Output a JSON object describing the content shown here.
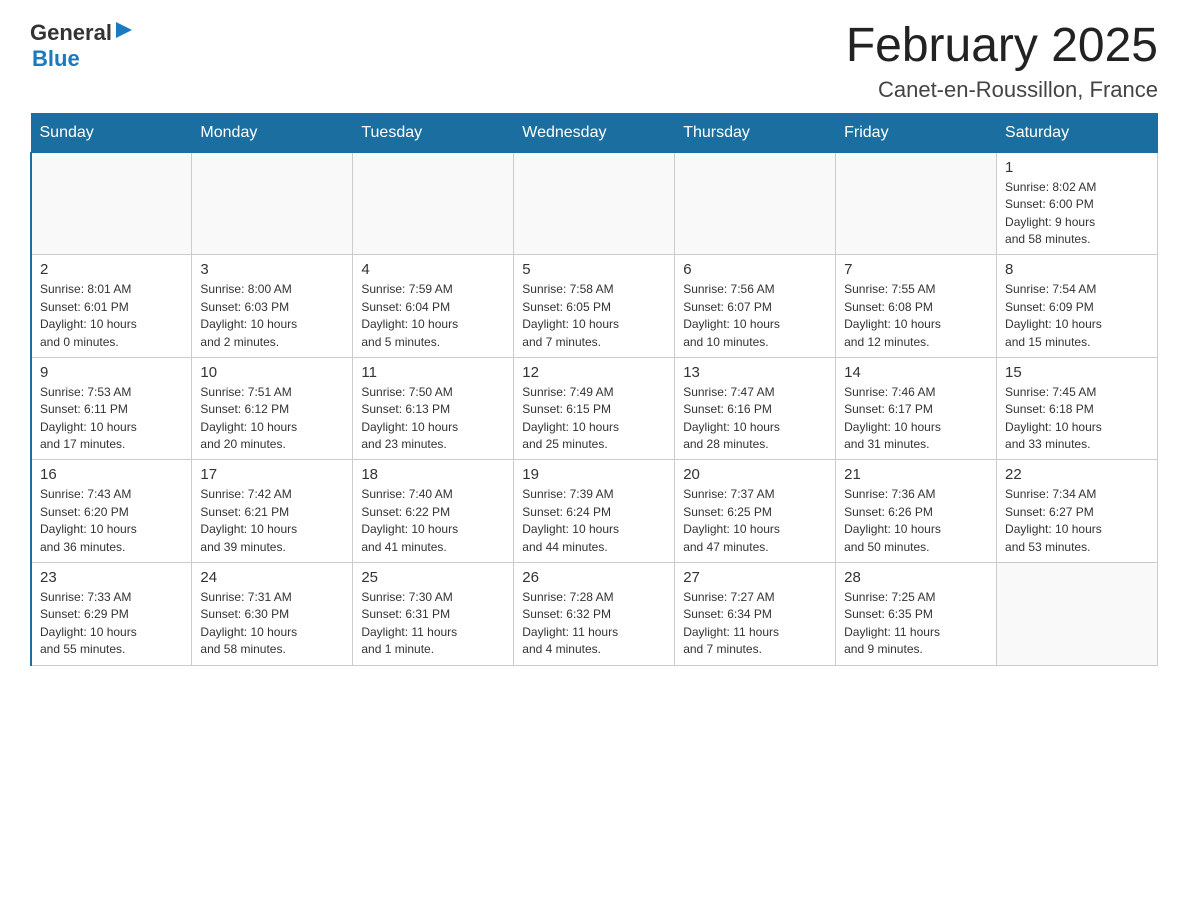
{
  "header": {
    "logo": {
      "text_general": "General",
      "text_blue": "Blue",
      "arrow": "▶"
    },
    "title": "February 2025",
    "subtitle": "Canet-en-Roussillon, France"
  },
  "weekdays": [
    "Sunday",
    "Monday",
    "Tuesday",
    "Wednesday",
    "Thursday",
    "Friday",
    "Saturday"
  ],
  "weeks": [
    [
      {
        "day": "",
        "info": ""
      },
      {
        "day": "",
        "info": ""
      },
      {
        "day": "",
        "info": ""
      },
      {
        "day": "",
        "info": ""
      },
      {
        "day": "",
        "info": ""
      },
      {
        "day": "",
        "info": ""
      },
      {
        "day": "1",
        "info": "Sunrise: 8:02 AM\nSunset: 6:00 PM\nDaylight: 9 hours\nand 58 minutes."
      }
    ],
    [
      {
        "day": "2",
        "info": "Sunrise: 8:01 AM\nSunset: 6:01 PM\nDaylight: 10 hours\nand 0 minutes."
      },
      {
        "day": "3",
        "info": "Sunrise: 8:00 AM\nSunset: 6:03 PM\nDaylight: 10 hours\nand 2 minutes."
      },
      {
        "day": "4",
        "info": "Sunrise: 7:59 AM\nSunset: 6:04 PM\nDaylight: 10 hours\nand 5 minutes."
      },
      {
        "day": "5",
        "info": "Sunrise: 7:58 AM\nSunset: 6:05 PM\nDaylight: 10 hours\nand 7 minutes."
      },
      {
        "day": "6",
        "info": "Sunrise: 7:56 AM\nSunset: 6:07 PM\nDaylight: 10 hours\nand 10 minutes."
      },
      {
        "day": "7",
        "info": "Sunrise: 7:55 AM\nSunset: 6:08 PM\nDaylight: 10 hours\nand 12 minutes."
      },
      {
        "day": "8",
        "info": "Sunrise: 7:54 AM\nSunset: 6:09 PM\nDaylight: 10 hours\nand 15 minutes."
      }
    ],
    [
      {
        "day": "9",
        "info": "Sunrise: 7:53 AM\nSunset: 6:11 PM\nDaylight: 10 hours\nand 17 minutes."
      },
      {
        "day": "10",
        "info": "Sunrise: 7:51 AM\nSunset: 6:12 PM\nDaylight: 10 hours\nand 20 minutes."
      },
      {
        "day": "11",
        "info": "Sunrise: 7:50 AM\nSunset: 6:13 PM\nDaylight: 10 hours\nand 23 minutes."
      },
      {
        "day": "12",
        "info": "Sunrise: 7:49 AM\nSunset: 6:15 PM\nDaylight: 10 hours\nand 25 minutes."
      },
      {
        "day": "13",
        "info": "Sunrise: 7:47 AM\nSunset: 6:16 PM\nDaylight: 10 hours\nand 28 minutes."
      },
      {
        "day": "14",
        "info": "Sunrise: 7:46 AM\nSunset: 6:17 PM\nDaylight: 10 hours\nand 31 minutes."
      },
      {
        "day": "15",
        "info": "Sunrise: 7:45 AM\nSunset: 6:18 PM\nDaylight: 10 hours\nand 33 minutes."
      }
    ],
    [
      {
        "day": "16",
        "info": "Sunrise: 7:43 AM\nSunset: 6:20 PM\nDaylight: 10 hours\nand 36 minutes."
      },
      {
        "day": "17",
        "info": "Sunrise: 7:42 AM\nSunset: 6:21 PM\nDaylight: 10 hours\nand 39 minutes."
      },
      {
        "day": "18",
        "info": "Sunrise: 7:40 AM\nSunset: 6:22 PM\nDaylight: 10 hours\nand 41 minutes."
      },
      {
        "day": "19",
        "info": "Sunrise: 7:39 AM\nSunset: 6:24 PM\nDaylight: 10 hours\nand 44 minutes."
      },
      {
        "day": "20",
        "info": "Sunrise: 7:37 AM\nSunset: 6:25 PM\nDaylight: 10 hours\nand 47 minutes."
      },
      {
        "day": "21",
        "info": "Sunrise: 7:36 AM\nSunset: 6:26 PM\nDaylight: 10 hours\nand 50 minutes."
      },
      {
        "day": "22",
        "info": "Sunrise: 7:34 AM\nSunset: 6:27 PM\nDaylight: 10 hours\nand 53 minutes."
      }
    ],
    [
      {
        "day": "23",
        "info": "Sunrise: 7:33 AM\nSunset: 6:29 PM\nDaylight: 10 hours\nand 55 minutes."
      },
      {
        "day": "24",
        "info": "Sunrise: 7:31 AM\nSunset: 6:30 PM\nDaylight: 10 hours\nand 58 minutes."
      },
      {
        "day": "25",
        "info": "Sunrise: 7:30 AM\nSunset: 6:31 PM\nDaylight: 11 hours\nand 1 minute."
      },
      {
        "day": "26",
        "info": "Sunrise: 7:28 AM\nSunset: 6:32 PM\nDaylight: 11 hours\nand 4 minutes."
      },
      {
        "day": "27",
        "info": "Sunrise: 7:27 AM\nSunset: 6:34 PM\nDaylight: 11 hours\nand 7 minutes."
      },
      {
        "day": "28",
        "info": "Sunrise: 7:25 AM\nSunset: 6:35 PM\nDaylight: 11 hours\nand 9 minutes."
      },
      {
        "day": "",
        "info": ""
      }
    ]
  ]
}
